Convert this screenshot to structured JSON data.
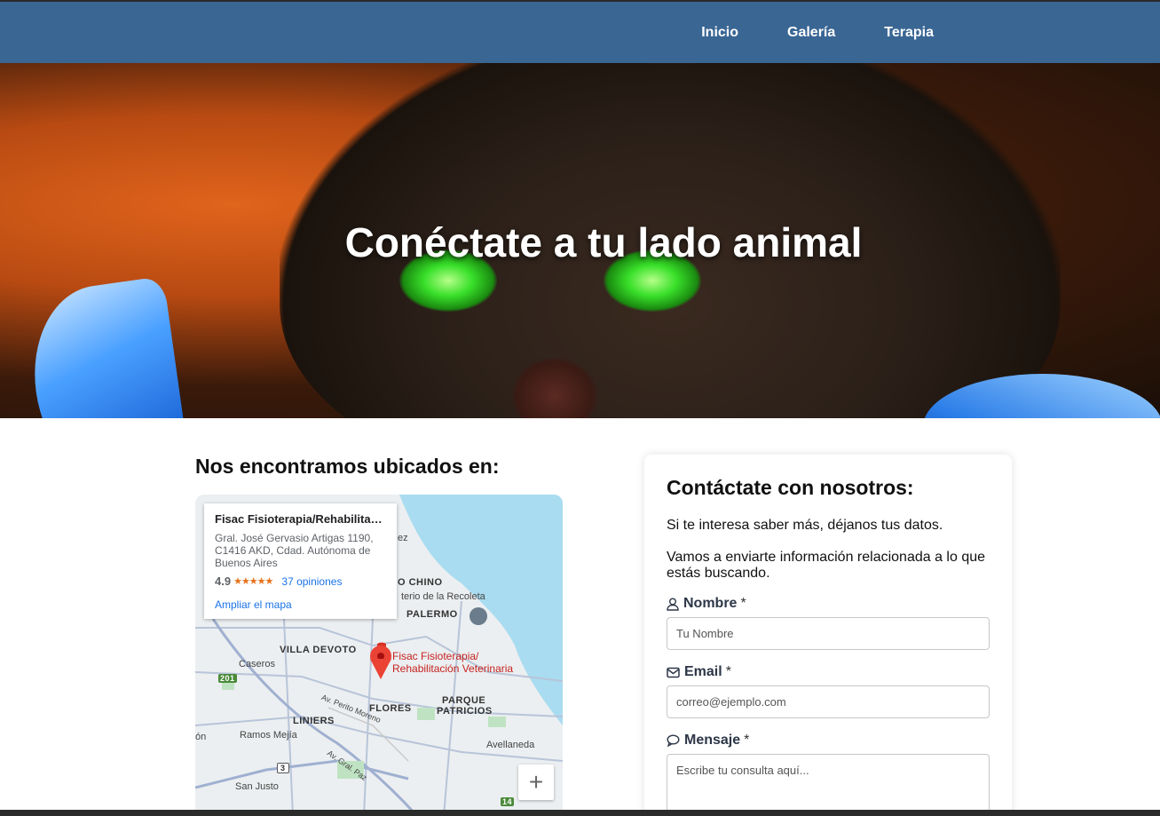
{
  "nav": {
    "items": [
      {
        "label": "Inicio"
      },
      {
        "label": "Galería"
      },
      {
        "label": "Terapia"
      }
    ]
  },
  "hero": {
    "title": "Conéctate a tu lado animal"
  },
  "location": {
    "title": "Nos encontramos ubicados en:",
    "map": {
      "place_name": "Fisac Fisioterapia/Rehabilitación Veterinaria",
      "address": "Gral. José Gervasio Artigas 1190, C1416 AKD, Cdad. Autónoma de Buenos Aires",
      "rating": "4.9",
      "stars": "★★★★★",
      "reviews": "37 opiniones",
      "enlarge": "Ampliar el mapa",
      "pin_label_1": "Fisac Fisioterapia/",
      "pin_label_2": "Rehabilitación Veterinaria",
      "zoom_in": "+",
      "labels": {
        "recoleta": "terio de la Recoleta",
        "chino": "O CHINO",
        "palermo": "PALERMO",
        "villa_devoto": "VILLA DEVOTO",
        "caseros": "Caseros",
        "flores": "FLORES",
        "parque": "PARQUE",
        "patricios": "PATRICIOS",
        "liniers": "LINIERS",
        "ramos": "Ramos Mejía",
        "avellaneda": "Avellaneda",
        "san_justo": "San Justo",
        "petit": "Av. Perito Moreno",
        "gral_paz": "Av. Gral. Paz",
        "ez": "ez",
        "on": "ón",
        "r201": "201",
        "r3": "3",
        "r14": "14"
      }
    }
  },
  "contact": {
    "title": "Contáctate con nosotros:",
    "intro": "Si te interesa saber más, déjanos tus datos.",
    "intro2": "Vamos a enviarte información relacionada a lo que estás buscando.",
    "name_label": "Nombre",
    "name_placeholder": "Tu Nombre",
    "email_label": "Email",
    "email_placeholder": "correo@ejemplo.com",
    "message_label": "Mensaje",
    "message_placeholder": "Escribe tu consulta aquí...",
    "required_mark": "*"
  },
  "colors": {
    "nav_bg": "#3a6694",
    "accent_link": "#1a73e8",
    "pin": "#d93025"
  }
}
